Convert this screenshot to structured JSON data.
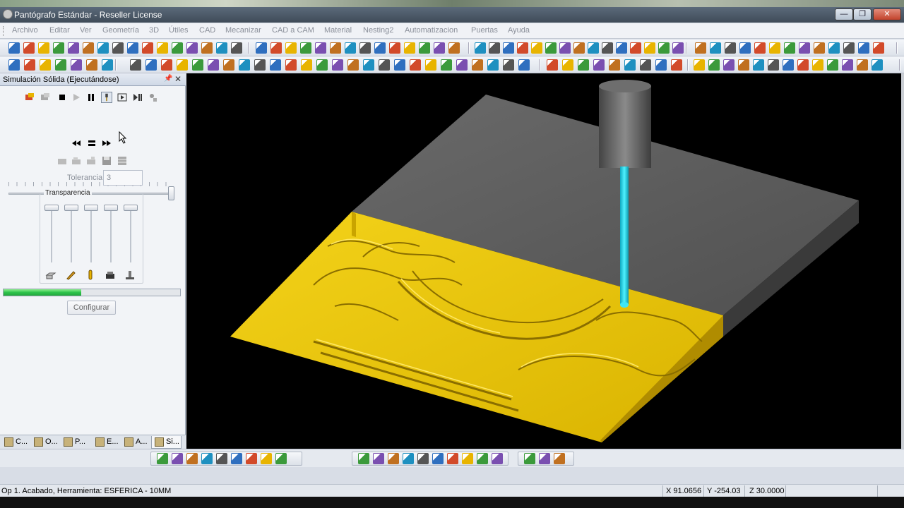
{
  "window": {
    "title": "Pantógrafo Estándar - Reseller License",
    "min_label": "—",
    "max_label": "❐",
    "close_label": "✕"
  },
  "menu": [
    "Archivo",
    "Editar",
    "Ver",
    "Geometría",
    "3D",
    "Útiles",
    "CAD",
    "Mecanizar",
    "CAD a CAM",
    "Material",
    "Nesting2",
    "Automatizacion",
    "Puertas",
    "Ayuda"
  ],
  "panel": {
    "title": "Simulación Sólida (Ejecutándose)",
    "pin_icon": "📌",
    "close_icon": "✕",
    "tolerance_label": "Tolerancia",
    "tolerance_value": "3",
    "transparency_label": "Transparencia",
    "progress": 0.44,
    "configure_label": "Configurar",
    "tabs": [
      "C...",
      "O...",
      "P...",
      "E...",
      "A...",
      "Si..."
    ]
  },
  "playback": {
    "row1_icons": [
      "run-all-icon",
      "run-selected-icon",
      "stop-icon",
      "play-icon",
      "pause-icon",
      "tool-view-icon",
      "step-icon",
      "step-end-icon",
      "extra-icon"
    ],
    "row2_icons": [
      "rewind-icon",
      "stop-small-icon",
      "forward-icon"
    ],
    "row3_icons": [
      "cam1-icon",
      "cam2-icon",
      "cam3-icon",
      "save-icon",
      "grid-icon"
    ]
  },
  "status": {
    "operation": "Op 1. Acabado, Herramienta: ESFERICA - 10MM",
    "x": "X 91.0656",
    "y": "Y -254.03",
    "z": "Z 30.0000"
  },
  "colors": {
    "part_gold": "#e8c400",
    "block_gray": "#5d5d5d",
    "tool_cyan": "#21d4e8",
    "viewport_bg": "#000000"
  }
}
